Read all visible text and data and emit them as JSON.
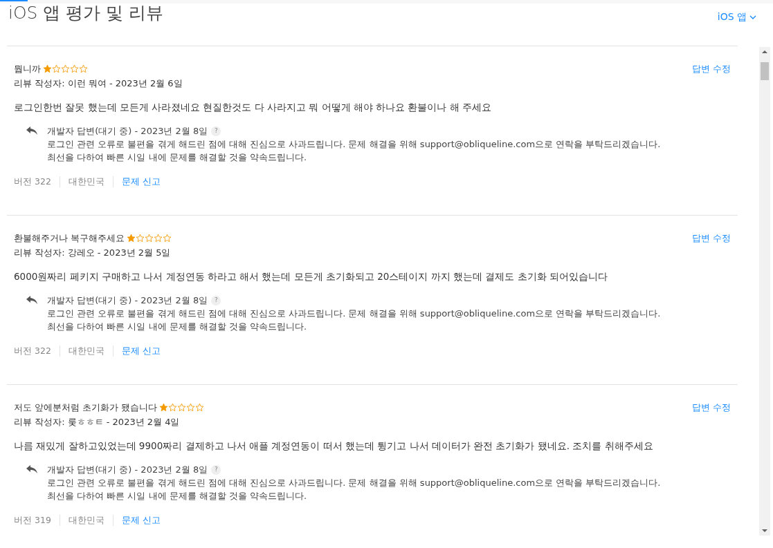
{
  "page_title": "iOS 앱 평가 및 리뷰",
  "platform_menu": {
    "label": "iOS 앱"
  },
  "reviews": [
    {
      "title": "뭡니까",
      "stars": 1,
      "author_line": "리뷰 작성자: 이런 뭐여 - 2023년 2월 6일",
      "edit_link": "답변 수정",
      "body": "로그인한번 잘못 했는데 모든게 사라졌네요 현질한것도 다 사라지고 뭐 어떻게 해야 하나요 환불이나 해 주세요",
      "reply": {
        "header": "개발자 답변(대기 중) - 2023년 2월 8일",
        "help": "?",
        "text": "로그인 관련 오류로 불편을 겪게 해드린 점에 대해 진심으로 사과드립니다. 문제 해결을 위해 support@obliqueline.com으로 연락을 부탁드리겠습니다.\n최선을 다하여 빠른 시일 내에 문제를 해결할 것을 약속드립니다."
      },
      "version": "버전 322",
      "country": "대한민국",
      "report_link": "문제 신고"
    },
    {
      "title": "환불해주거나 복구해주세요",
      "stars": 1,
      "author_line": "리뷰 작성자: 강레오 - 2023년 2월 5일",
      "edit_link": "답변 수정",
      "body": "6000원짜리 페키지 구매하고 나서 계정연동 하라고 해서 했는데 모든게 초기화되고 20스테이지 까지 했는데 결제도 초기화 되어있습니다",
      "reply": {
        "header": "개발자 답변(대기 중) - 2023년 2월 8일",
        "help": "?",
        "text": "로그인 관련 오류로 불편을 겪게 해드린 점에 대해 진심으로 사과드립니다. 문제 해결을 위해 support@obliqueline.com으로 연락을 부탁드리겠습니다.\n최선을 다하여 빠른 시일 내에 문제를 해결할 것을 약속드립니다."
      },
      "version": "버전 322",
      "country": "대한민국",
      "report_link": "문제 신고"
    },
    {
      "title": "저도 앞에분처럼 초기화가 됐습니다",
      "stars": 1,
      "author_line": "리뷰 작성자: 룾ㅎㅎㅌ - 2023년 2월 4일",
      "edit_link": "답변 수정",
      "body": "나름 재밌게 잘하고있었는데 9900짜리 결제하고 나서 애플 계정연동이 떠서 했는데 튕기고 나서 데이터가 완전 초기화가 됐네요. 조치를 취해주세요",
      "reply": {
        "header": "개발자 답변(대기 중) - 2023년 2월 8일",
        "help": "?",
        "text": "로그인 관련 오류로 불편을 겪게 해드린 점에 대해 진심으로 사과드립니다. 문제 해결을 위해 support@obliqueline.com으로 연락을 부탁드리겠습니다.\n최선을 다하여 빠른 시일 내에 문제를 해결할 것을 약속드립니다."
      },
      "version": "버전 319",
      "country": "대한민국",
      "report_link": "문제 신고"
    }
  ]
}
